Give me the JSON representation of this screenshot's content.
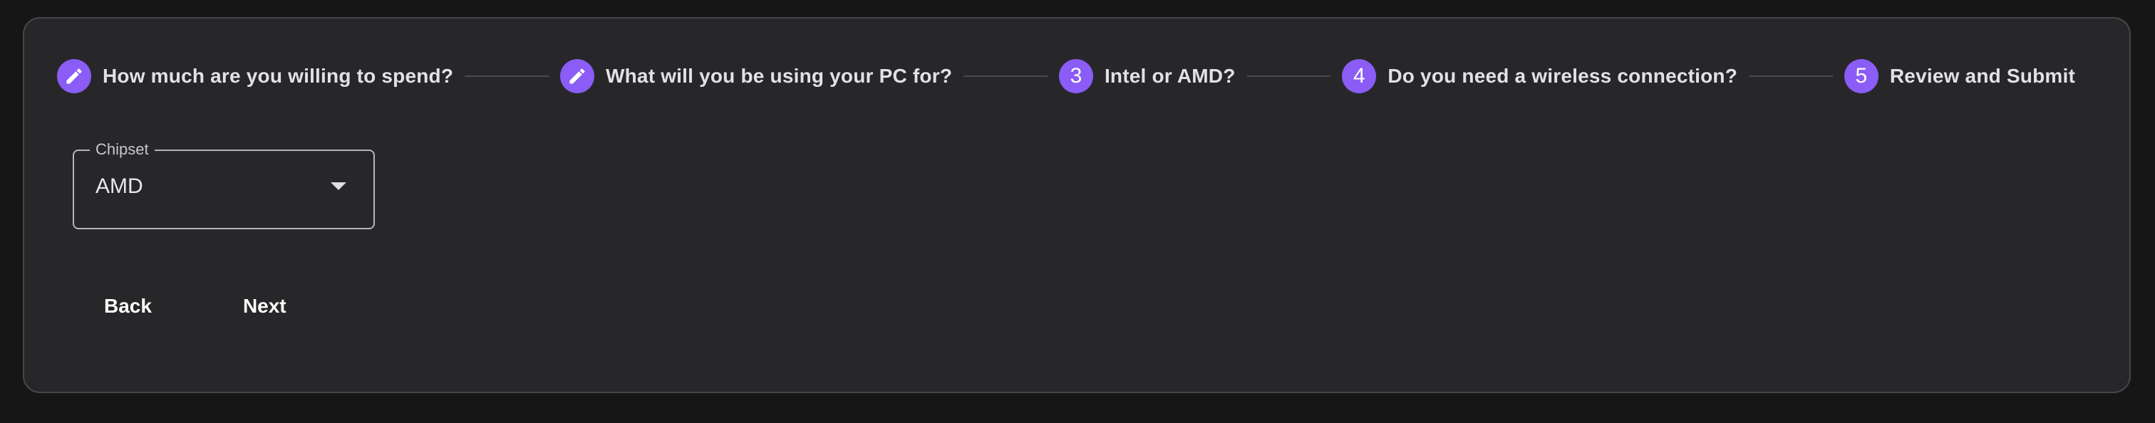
{
  "stepper": {
    "steps": [
      {
        "label": "How much are you willing to spend?",
        "icon": "pencil-icon",
        "indicator": ""
      },
      {
        "label": "What will you be using your PC for?",
        "icon": "pencil-icon",
        "indicator": ""
      },
      {
        "label": "Intel or AMD?",
        "icon": "",
        "indicator": "3"
      },
      {
        "label": "Do you need a wireless connection?",
        "icon": "",
        "indicator": "4"
      },
      {
        "label": "Review and Submit",
        "icon": "",
        "indicator": "5"
      }
    ],
    "accent_color": "#8b5cf6"
  },
  "form": {
    "chipset": {
      "label": "Chipset",
      "value": "AMD"
    }
  },
  "actions": {
    "back_label": "Back",
    "next_label": "Next"
  }
}
